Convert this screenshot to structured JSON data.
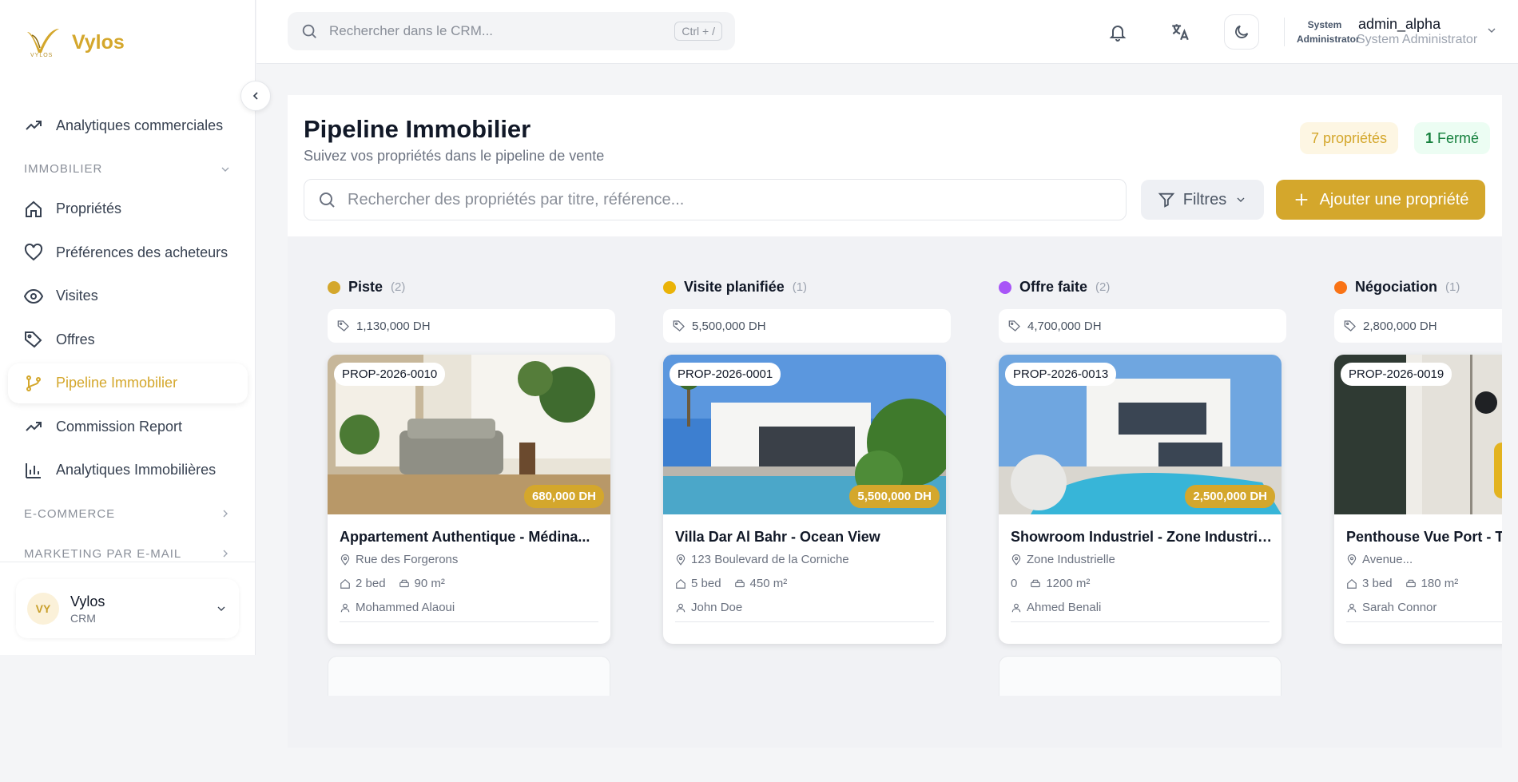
{
  "brand": {
    "name": "Vylos",
    "logo_letters": "VYLOS"
  },
  "sidebar": {
    "items": [
      {
        "label": "Analytiques commerciales",
        "icon": "trending-up-icon"
      },
      {
        "label": "IMMOBILIER",
        "section": true
      },
      {
        "label": "Propriétés",
        "icon": "home-icon"
      },
      {
        "label": "Préférences des acheteurs",
        "icon": "heart-icon"
      },
      {
        "label": "Visites",
        "icon": "eye-icon"
      },
      {
        "label": "Offres",
        "icon": "tag-icon"
      },
      {
        "label": "Pipeline Immobilier",
        "icon": "git-branch-icon",
        "active": true
      },
      {
        "label": "Commission Report",
        "icon": "trending-up-icon"
      },
      {
        "label": "Analytiques Immobilières",
        "icon": "bar-chart-icon"
      },
      {
        "label": "E-COMMERCE",
        "section": true
      },
      {
        "label": "MARKETING PAR E-MAIL",
        "section": true
      }
    ],
    "org": {
      "avatar": "VY",
      "name": "Vylos",
      "sub": "CRM"
    }
  },
  "topbar": {
    "search_placeholder": "Rechercher dans le CRM...",
    "shortcut": "Ctrl + /",
    "user": {
      "role_small": "System Administrator",
      "name": "admin_alpha",
      "role": "System Administrator"
    }
  },
  "page": {
    "title": "Pipeline Immobilier",
    "subtitle": "Suivez vos propriétés dans le pipeline de vente",
    "badge_props": "7 propriétés",
    "badge_closed_count": "1",
    "badge_closed_label": "Fermé",
    "search_placeholder": "Rechercher des propriétés par titre, référence...",
    "filters_label": "Filtres",
    "add_label": "Ajouter une propriété"
  },
  "colors": {
    "accent": "#d4a72c"
  },
  "columns": [
    {
      "title": "Piste",
      "count": "(2)",
      "color": "#d4a72c",
      "total": "1,130,000 DH",
      "card": {
        "ref": "PROP-2026-0010",
        "price": "680,000 DH",
        "title": "Appartement Authentique - Médina...",
        "address": "Rue des Forgerons",
        "beds": "2 bed",
        "area": "90 m²",
        "agent": "Mohammed Alaoui"
      }
    },
    {
      "title": "Visite planifiée",
      "count": "(1)",
      "color": "#eab308",
      "total": "5,500,000 DH",
      "card": {
        "ref": "PROP-2026-0001",
        "price": "5,500,000 DH",
        "title": "Villa Dar Al Bahr - Ocean View",
        "address": "123 Boulevard de la Corniche",
        "beds": "5 bed",
        "area": "450 m²",
        "agent": "John Doe"
      }
    },
    {
      "title": "Offre faite",
      "count": "(2)",
      "color": "#a855f7",
      "total": "4,700,000 DH",
      "card": {
        "ref": "PROP-2026-0013",
        "price": "2,500,000 DH",
        "title": "Showroom Industriel - Zone Industrielle",
        "address": "Zone Industrielle",
        "beds": "0",
        "area": "1200 m²",
        "agent": "Ahmed Benali"
      }
    },
    {
      "title": "Négociation",
      "count": "(1)",
      "color": "#f97316",
      "total": "2,800,000 DH",
      "card": {
        "ref": "PROP-2026-0019",
        "price": "",
        "title": "Penthouse Vue Port - Tanger",
        "address": "Avenue...",
        "beds": "3 bed",
        "area": "180 m²",
        "agent": "Sarah Connor"
      }
    }
  ]
}
